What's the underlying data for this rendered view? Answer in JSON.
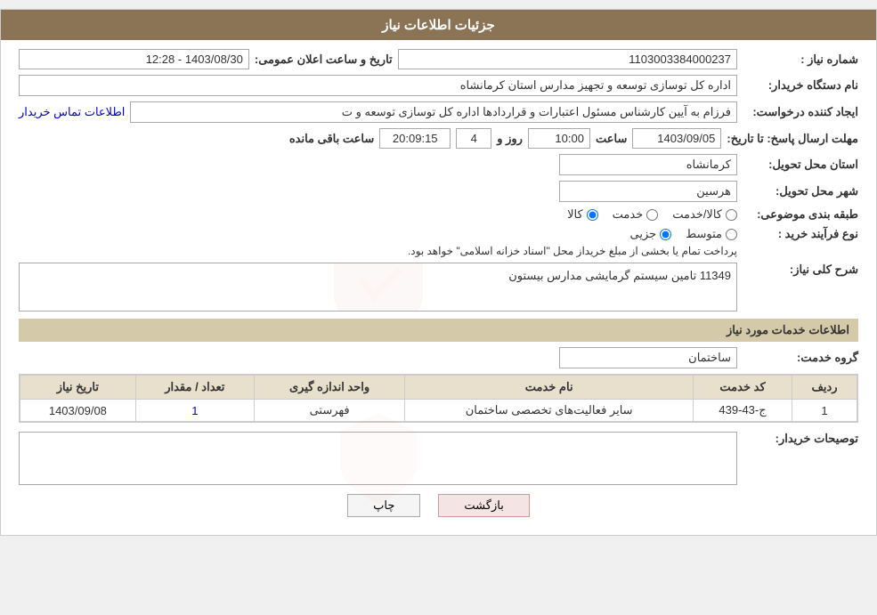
{
  "page": {
    "title": "جزئیات اطلاعات نیاز"
  },
  "header": {
    "shomareNiaz_label": "شماره نیاز :",
    "shomareNiaz_value": "1103003384000237",
    "tarikh_label": "تاریخ و ساعت اعلان عمومی:",
    "tarikh_value": "1403/08/30 - 12:28",
    "namDasgah_label": "نام دستگاه خریدار:",
    "namDasgah_value": "اداره کل توسازی  توسعه و تجهیز مدارس استان کرمانشاه",
    "ijadKonande_label": "ایجاد کننده درخواست:",
    "ijadKonande_value": "فرزام به آیین کارشناس مسئول اعتبارات و قراردادها اداره کل توسازی  توسعه و ت",
    "ijadKonande_link": "اطلاعات تماس خریدار",
    "mohlat_label": "مهلت ارسال پاسخ: تا تاریخ:",
    "mohlat_date": "1403/09/05",
    "mohlat_saaat_label": "ساعت",
    "mohlat_saaat_value": "10:00",
    "mohlat_rooz_label": "روز و",
    "mohlat_rooz_value": "4",
    "mohlat_baqi_label": "ساعت باقی مانده",
    "mohlat_baqi_value": "20:09:15",
    "ostan_label": "استان محل تحویل:",
    "ostan_value": "کرمانشاه",
    "shahr_label": "شهر محل تحویل:",
    "shahr_value": "هرسین",
    "tabaqe_label": "طبقه بندی موضوعی:",
    "tabaqe_options": [
      {
        "label": "کالا",
        "value": "kala"
      },
      {
        "label": "خدمت",
        "value": "khedmat"
      },
      {
        "label": "کالا/خدمت",
        "value": "kala_khedmat"
      }
    ],
    "tabaqe_selected": "kala",
    "noFarayand_label": "نوع فرآیند خرید :",
    "noFarayand_options": [
      {
        "label": "جزیی",
        "value": "jozi"
      },
      {
        "label": "متوسط",
        "value": "motevaset"
      }
    ],
    "noFarayand_text": "پرداخت تمام یا بخشی از مبلغ خریداز محل \"اسناد خزانه اسلامی\" خواهد بود.",
    "sharhKoli_label": "شرح کلی نیاز:",
    "sharhKoli_value": "11349 تامین سیستم گرمایشی مدارس بیستون"
  },
  "services": {
    "section_title": "اطلاعات خدمات مورد نیاز",
    "groohKhedmat_label": "گروه خدمت:",
    "groohKhedmat_value": "ساختمان",
    "table": {
      "columns": [
        "ردیف",
        "کد خدمت",
        "نام خدمت",
        "واحد اندازه گیری",
        "تعداد / مقدار",
        "تاریخ نیاز"
      ],
      "rows": [
        {
          "radif": "1",
          "kodKhedmat": "ج-43-439",
          "namKhedmat": "سایر فعالیت‌های تخصصی ساختمان",
          "vahed": "فهرستی",
          "tedad": "1",
          "tarikh": "1403/09/08"
        }
      ]
    }
  },
  "buyer": {
    "toseif_label": "توصیحات خریدار:"
  },
  "buttons": {
    "print_label": "چاپ",
    "back_label": "بازگشت"
  }
}
